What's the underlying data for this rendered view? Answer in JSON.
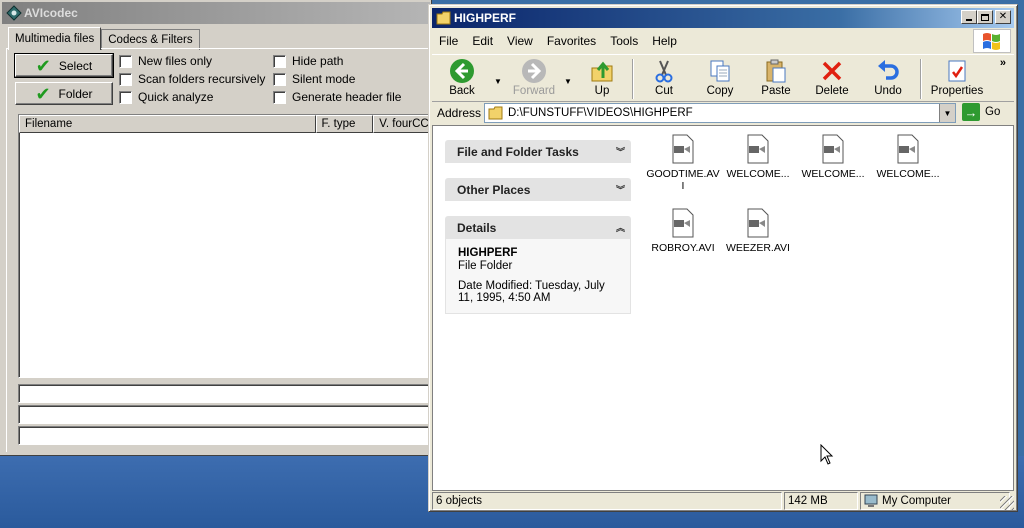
{
  "avicodec": {
    "title": "AVIcodec",
    "tabs": [
      "Multimedia files",
      "Codecs & Filters"
    ],
    "select_button": "Select",
    "folder_button": "Folder",
    "options": {
      "new_files_only": "New files only",
      "scan_recursively": "Scan folders recursively",
      "quick_analyze": "Quick analyze",
      "hide_path": "Hide path",
      "silent_mode": "Silent mode",
      "generate_header": "Generate header file"
    },
    "columns": [
      "Filename",
      "F. type",
      "V. fourCC"
    ]
  },
  "explorer": {
    "title": "HIGHPERF",
    "menu": [
      "File",
      "Edit",
      "View",
      "Favorites",
      "Tools",
      "Help"
    ],
    "toolbar": {
      "back": "Back",
      "forward": "Forward",
      "up": "Up",
      "cut": "Cut",
      "copy": "Copy",
      "paste": "Paste",
      "delete": "Delete",
      "undo": "Undo",
      "properties": "Properties"
    },
    "address_label": "Address",
    "address_value": "D:\\FUNSTUFF\\VIDEOS\\HIGHPERF",
    "go_label": "Go",
    "tasks": {
      "file_folder": "File and Folder Tasks",
      "other_places": "Other Places",
      "details": "Details"
    },
    "details": {
      "name": "HIGHPERF",
      "type": "File Folder",
      "date": "Date Modified: Tuesday, July 11, 1995, 4:50 AM"
    },
    "files": [
      "GOODTIME.AVI",
      "WELCOME...",
      "WELCOME...",
      "WELCOME...",
      "ROBROY.AVI",
      "WEEZER.AVI"
    ],
    "status": {
      "objects": "6 objects",
      "size": "142 MB",
      "location": "My Computer"
    }
  },
  "colors": {
    "desktop": "#3a6ea5",
    "active_title": "#0a246a",
    "inactive_title": "#808080"
  }
}
